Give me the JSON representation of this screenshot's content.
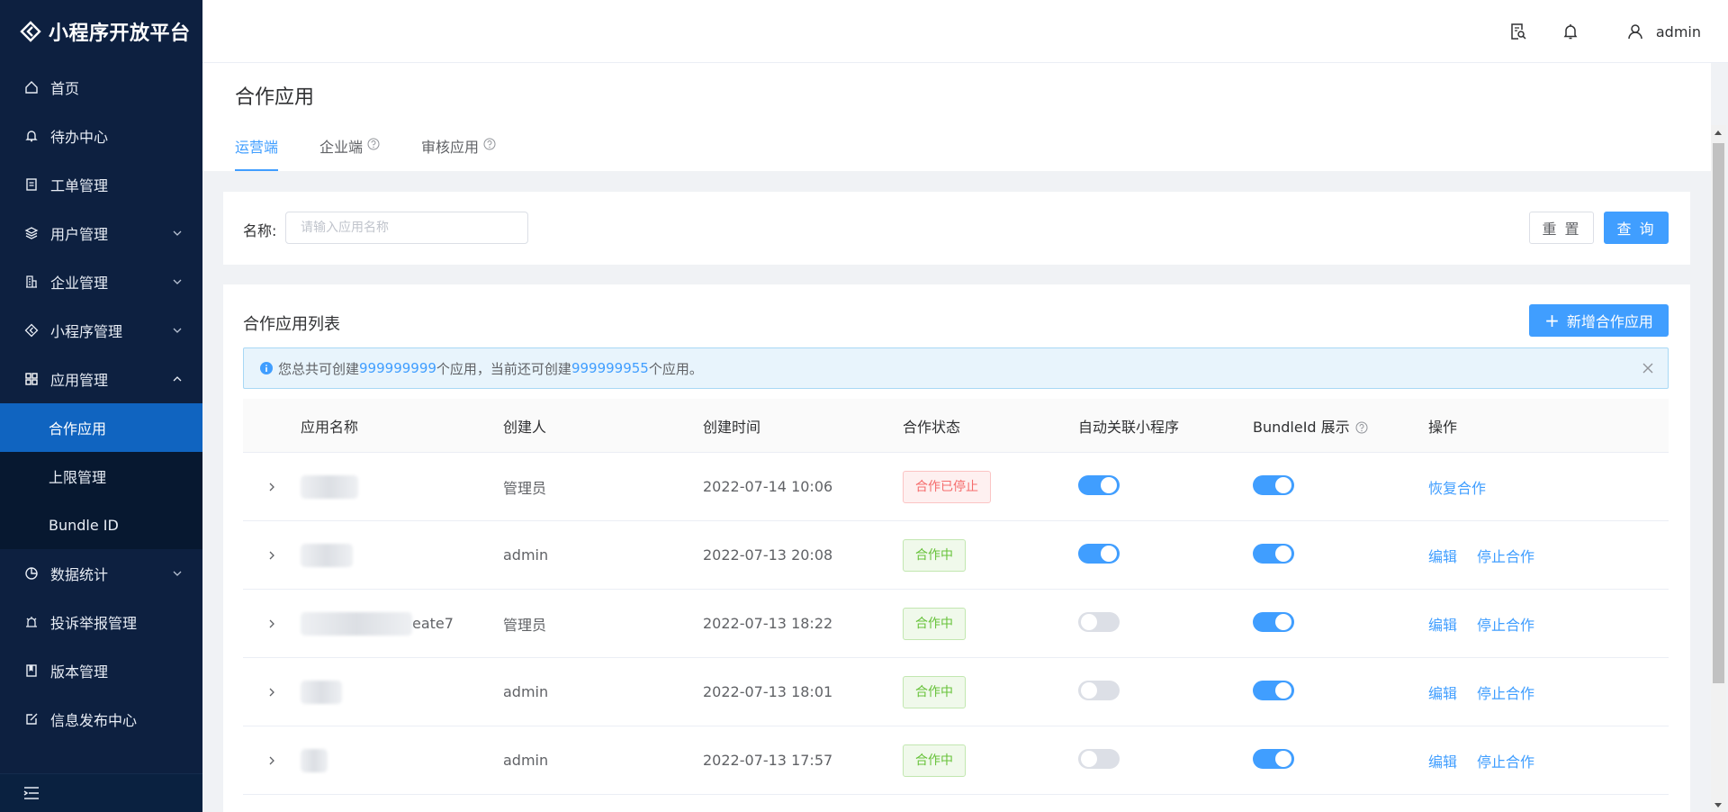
{
  "app": {
    "title": "小程序开放平台"
  },
  "sidebar": {
    "items": [
      {
        "label": "首页",
        "icon": "home-icon"
      },
      {
        "label": "待办中心",
        "icon": "bell-icon"
      },
      {
        "label": "工单管理",
        "icon": "clipboard-icon"
      },
      {
        "label": "用户管理",
        "icon": "layers-icon",
        "expandable": true
      },
      {
        "label": "企业管理",
        "icon": "building-icon",
        "expandable": true
      },
      {
        "label": "小程序管理",
        "icon": "diamond-icon",
        "expandable": true
      },
      {
        "label": "应用管理",
        "icon": "grid-icon",
        "expandable": true,
        "expanded": true
      },
      {
        "label": "数据统计",
        "icon": "pie-chart-icon",
        "expandable": true
      },
      {
        "label": "投诉举报管理",
        "icon": "alarm-icon"
      },
      {
        "label": "版本管理",
        "icon": "book-icon"
      },
      {
        "label": "信息发布中心",
        "icon": "edit-icon"
      }
    ],
    "sub_items": [
      "合作应用",
      "上限管理",
      "Bundle ID"
    ],
    "active_sub": "合作应用"
  },
  "header": {
    "username": "admin"
  },
  "page": {
    "title": "合作应用",
    "tabs": [
      {
        "label": "运营端",
        "active": true
      },
      {
        "label": "企业端",
        "has_help": true
      },
      {
        "label": "审核应用",
        "has_help": true
      }
    ]
  },
  "search": {
    "label": "名称:",
    "placeholder": "请输入应用名称",
    "reset_label": "重 置",
    "query_label": "查 询"
  },
  "list": {
    "title": "合作应用列表",
    "add_label": "新增合作应用",
    "alert": {
      "prefix": "您总共可创建",
      "total": "999999999",
      "middle": "个应用，当前还可创建",
      "remaining": "999999955",
      "suffix": "个应用。"
    },
    "columns": [
      "应用名称",
      "创建人",
      "创建时间",
      "合作状态",
      "自动关联小程序",
      "BundleId 展示",
      "操作"
    ],
    "rows": [
      {
        "name_suffix": "",
        "creator": "管理员",
        "time": "2022-07-14 10:06",
        "status": "合作已停止",
        "status_type": "stop",
        "auto_link": true,
        "bundle_show": true,
        "actions": [
          "恢复合作"
        ]
      },
      {
        "name_suffix": "",
        "creator": "admin",
        "time": "2022-07-13 20:08",
        "status": "合作中",
        "status_type": "on",
        "auto_link": true,
        "bundle_show": true,
        "actions": [
          "编辑",
          "停止合作"
        ]
      },
      {
        "name_suffix": "eate7",
        "creator": "管理员",
        "time": "2022-07-13 18:22",
        "status": "合作中",
        "status_type": "on",
        "auto_link": false,
        "bundle_show": true,
        "actions": [
          "编辑",
          "停止合作"
        ]
      },
      {
        "name_suffix": "",
        "creator": "admin",
        "time": "2022-07-13 18:01",
        "status": "合作中",
        "status_type": "on",
        "auto_link": false,
        "bundle_show": true,
        "actions": [
          "编辑",
          "停止合作"
        ]
      },
      {
        "name_suffix": "",
        "creator": "admin",
        "time": "2022-07-13 17:57",
        "status": "合作中",
        "status_type": "on",
        "auto_link": false,
        "bundle_show": true,
        "actions": [
          "编辑",
          "停止合作"
        ]
      }
    ]
  },
  "colors": {
    "sidebar_bg": "#0d2040",
    "active_bg": "#1064c0",
    "primary": "#409eff",
    "success": "#67c23a",
    "danger": "#f56c6c"
  }
}
